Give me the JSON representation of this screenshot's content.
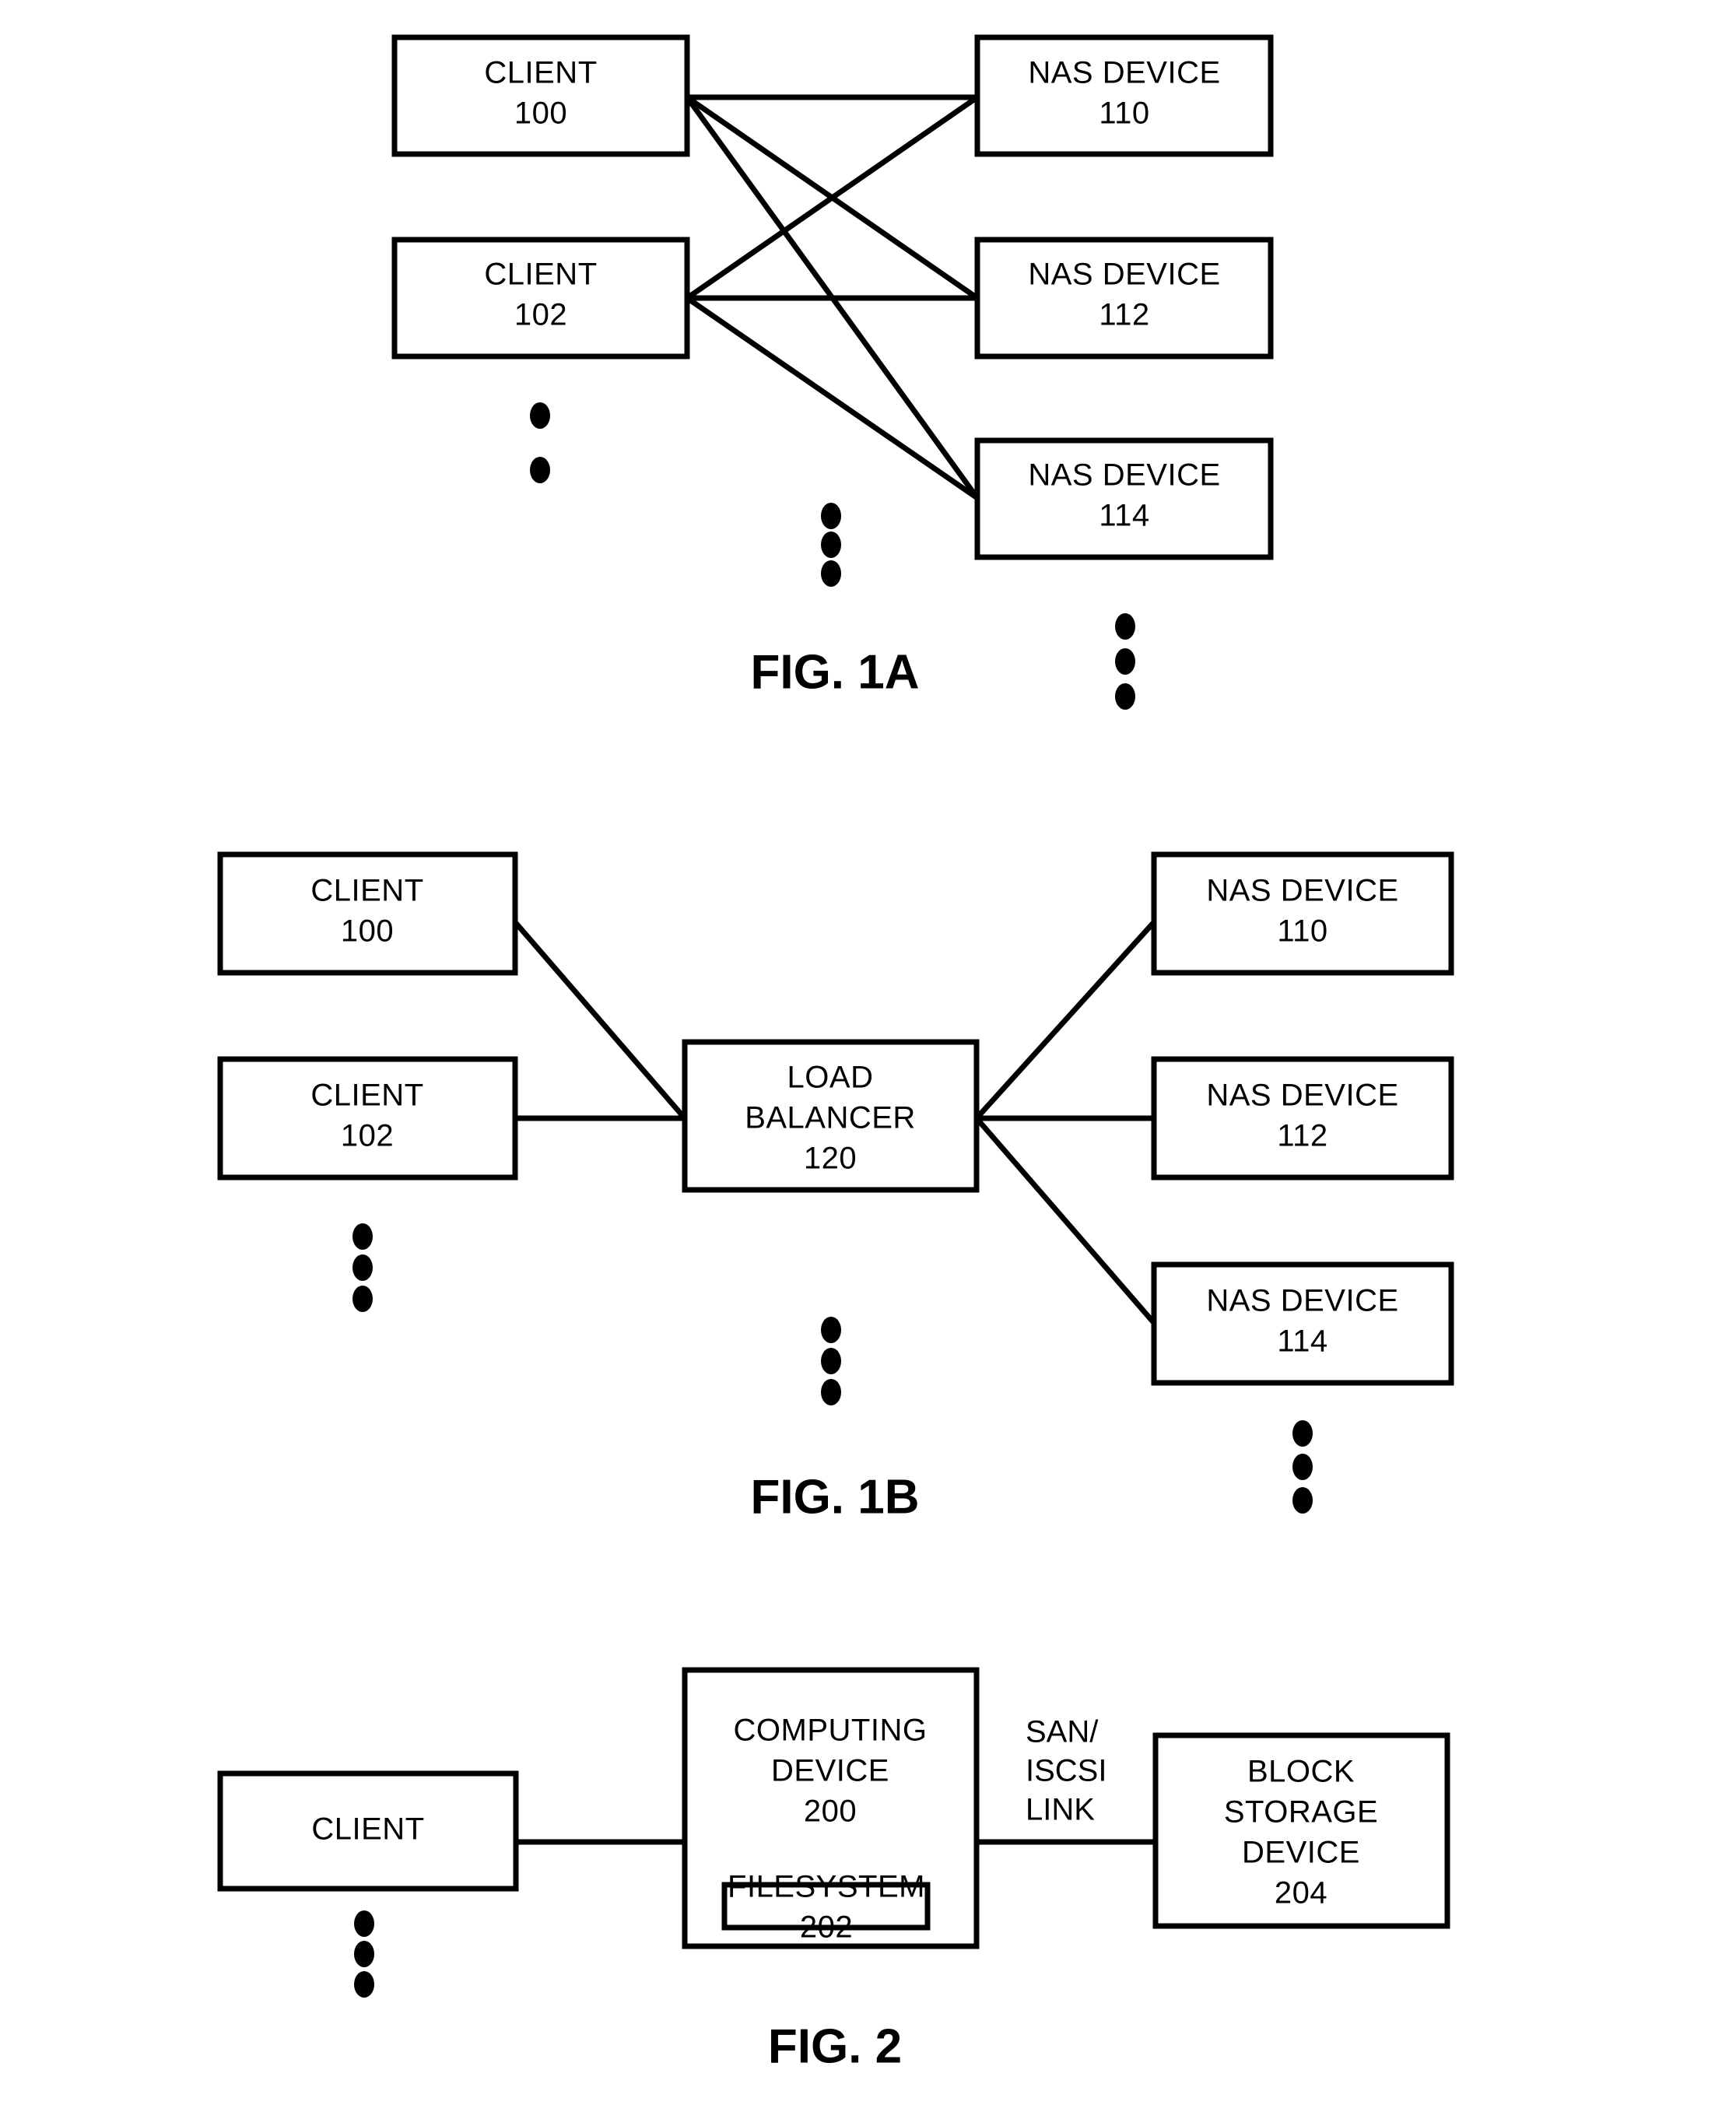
{
  "document": {
    "type": "patent-drawing-sheet",
    "background_color": "#ffffff",
    "line_color": "#000000"
  },
  "figures": [
    {
      "id": "fig-1a",
      "caption": "FIG. 1A",
      "nodes": [
        {
          "id": "client-100",
          "line1": "CLIENT",
          "line2": "100"
        },
        {
          "id": "client-102",
          "line1": "CLIENT",
          "line2": "102"
        },
        {
          "id": "nas-110",
          "line1": "NAS DEVICE",
          "line2": "110"
        },
        {
          "id": "nas-112",
          "line1": "NAS DEVICE",
          "line2": "112"
        },
        {
          "id": "nas-114",
          "line1": "NAS DEVICE",
          "line2": "114"
        }
      ],
      "connections": [
        {
          "from": "client-100",
          "to": "nas-110"
        },
        {
          "from": "client-100",
          "to": "nas-112"
        },
        {
          "from": "client-100",
          "to": "nas-114"
        },
        {
          "from": "client-102",
          "to": "nas-110"
        },
        {
          "from": "client-102",
          "to": "nas-112"
        },
        {
          "from": "client-102",
          "to": "nas-114"
        }
      ],
      "ellipses": [
        {
          "id": "clients-more",
          "dots": 2
        },
        {
          "id": "middle-more",
          "dots": 3
        },
        {
          "id": "nas-more",
          "dots": 3
        }
      ]
    },
    {
      "id": "fig-1b",
      "caption": "FIG. 1B",
      "nodes": [
        {
          "id": "client-100",
          "line1": "CLIENT",
          "line2": "100"
        },
        {
          "id": "client-102",
          "line1": "CLIENT",
          "line2": "102"
        },
        {
          "id": "load-balancer-120",
          "line1": "LOAD",
          "line2": "BALANCER",
          "line3": "120"
        },
        {
          "id": "nas-110",
          "line1": "NAS DEVICE",
          "line2": "110"
        },
        {
          "id": "nas-112",
          "line1": "NAS DEVICE",
          "line2": "112"
        },
        {
          "id": "nas-114",
          "line1": "NAS DEVICE",
          "line2": "114"
        }
      ],
      "connections": [
        {
          "from": "client-100",
          "to": "load-balancer-120"
        },
        {
          "from": "client-102",
          "to": "load-balancer-120"
        },
        {
          "from": "load-balancer-120",
          "to": "nas-110"
        },
        {
          "from": "load-balancer-120",
          "to": "nas-112"
        },
        {
          "from": "load-balancer-120",
          "to": "nas-114"
        }
      ],
      "ellipses": [
        {
          "id": "clients-more",
          "dots": 3
        },
        {
          "id": "middle-more",
          "dots": 3
        },
        {
          "id": "nas-more",
          "dots": 3
        }
      ]
    },
    {
      "id": "fig-2",
      "caption": "FIG. 2",
      "nodes": [
        {
          "id": "client",
          "line1": "CLIENT"
        },
        {
          "id": "computing-device-200",
          "line1": "COMPUTING",
          "line2": "DEVICE",
          "line3": "200"
        },
        {
          "id": "filesystem-202",
          "line1": "FILESYSTEM",
          "line2": "202"
        },
        {
          "id": "block-storage-204",
          "line1": "BLOCK",
          "line2": "STORAGE",
          "line3": "DEVICE",
          "line4": "204"
        }
      ],
      "link_labels": [
        {
          "id": "san-iscsi-link",
          "line1": "SAN/",
          "line2": "ISCSI",
          "line3": "LINK"
        }
      ],
      "connections": [
        {
          "from": "client",
          "to": "computing-device-200"
        },
        {
          "from": "computing-device-200",
          "to": "block-storage-204",
          "label": "san-iscsi-link"
        }
      ],
      "ellipses": [
        {
          "id": "clients-more",
          "dots": 3
        }
      ]
    }
  ]
}
